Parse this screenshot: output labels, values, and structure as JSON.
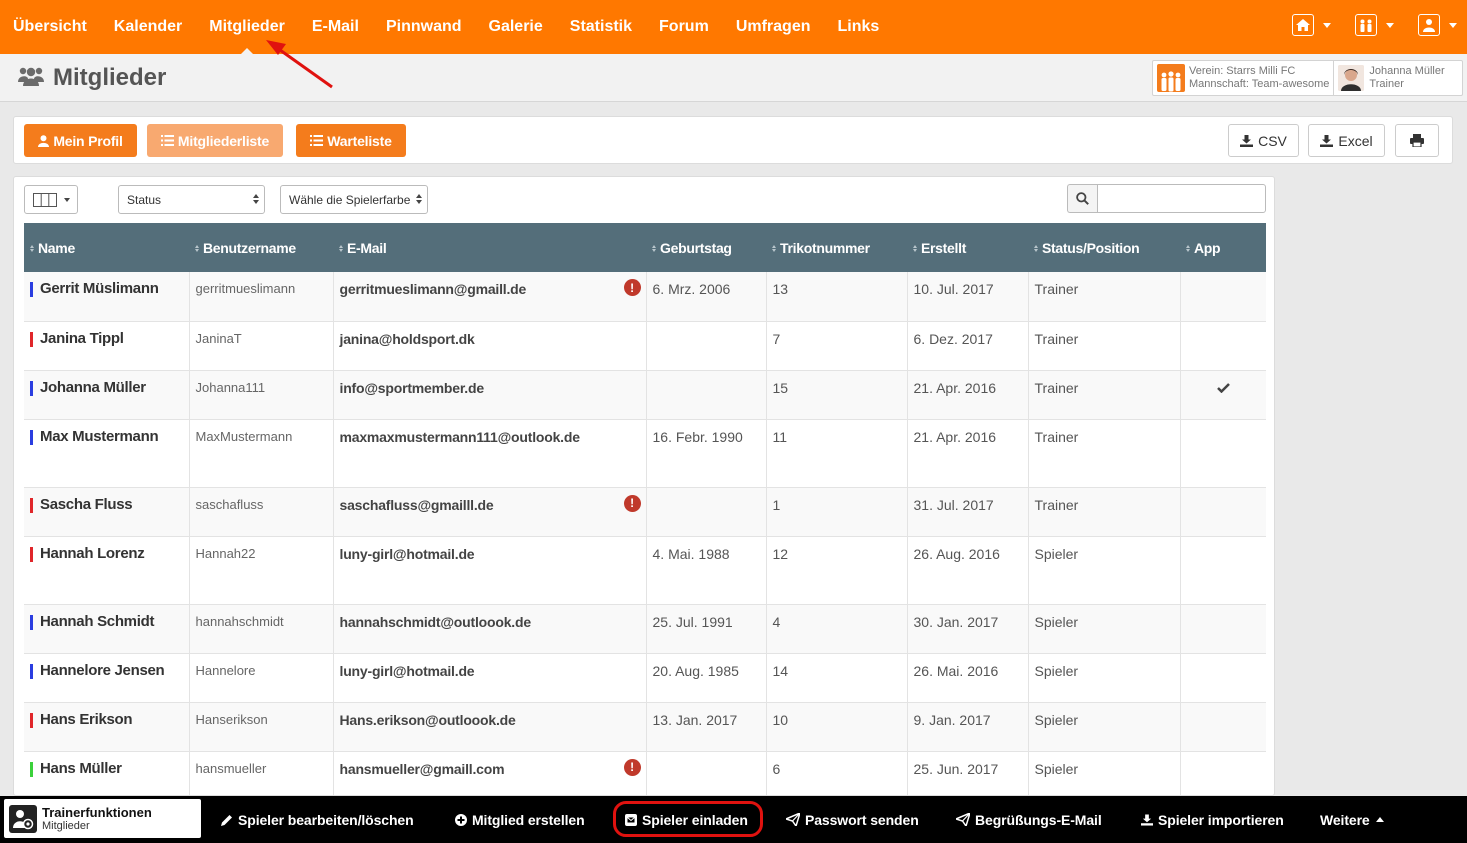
{
  "topnav": {
    "items": [
      "Übersicht",
      "Kalender",
      "Mitglieder",
      "E-Mail",
      "Pinnwand",
      "Galerie",
      "Statistik",
      "Forum",
      "Umfragen",
      "Links"
    ],
    "active": "Mitglieder",
    "right_icons": [
      "home-icon",
      "team-icon",
      "user-icon"
    ]
  },
  "header": {
    "title": "Mitglieder",
    "club_line1": "Verein: Starrs Milli FC",
    "club_line2": "Mannschaft: Team-awesome",
    "user_name": "Johanna Müller",
    "user_role": "Trainer"
  },
  "toolbar": {
    "my_profile": "Mein Profil",
    "member_list": "Mitgliederliste",
    "waiting_list": "Warteliste",
    "csv": "CSV",
    "excel": "Excel",
    "colors": {
      "primary": "#f47c1c",
      "active": "#f8a970"
    }
  },
  "filters": {
    "status": "Status",
    "player_color": "Wähle die Spielerfarbe",
    "search_value": ""
  },
  "table": {
    "columns": [
      "Name",
      "Benutzername",
      "E-Mail",
      "Geburtstag",
      "Trikotnummer",
      "Erstellt",
      "Status/Position",
      "App"
    ],
    "rows": [
      {
        "name": "Gerrit Müslimann",
        "color": "#2a3de0",
        "username": "gerritmueslimann",
        "email": "gerritmueslimann@gmaill.de",
        "warn": true,
        "birthday": "6. Mrz. 2006",
        "number": "13",
        "created": "10. Jul. 2017",
        "status": "Trainer",
        "app": false
      },
      {
        "name": "Janina Tippl",
        "color": "#e0262a",
        "username": "JaninaT",
        "email": "janina@holdsport.dk",
        "warn": false,
        "birthday": "",
        "number": "7",
        "created": "6. Dez. 2017",
        "status": "Trainer",
        "app": false
      },
      {
        "name": "Johanna Müller",
        "color": "#2a3de0",
        "username": "Johanna111",
        "email": "info@sportmember.de",
        "warn": false,
        "birthday": "",
        "number": "15",
        "created": "21. Apr. 2016",
        "status": "Trainer",
        "app": true
      },
      {
        "name": "Max Mustermann",
        "color": "#2a3de0",
        "username": "MaxMustermann",
        "email": "maxmaxmustermann111@outlook.de",
        "warn": false,
        "birthday": "16. Febr. 1990",
        "number": "11",
        "created": "21. Apr. 2016",
        "status": "Trainer",
        "app": false
      },
      {
        "name": "Sascha Fluss",
        "color": "#e0262a",
        "username": "saschafluss",
        "email": "saschafluss@gmailll.de",
        "warn": true,
        "birthday": "",
        "number": "1",
        "created": "31. Jul. 2017",
        "status": "Trainer",
        "app": false
      },
      {
        "name": "Hannah Lorenz",
        "color": "#e0262a",
        "username": "Hannah22",
        "email": "luny-girl@hotmail.de",
        "warn": false,
        "birthday": "4. Mai. 1988",
        "number": "12",
        "created": "26. Aug. 2016",
        "status": "Spieler",
        "app": false
      },
      {
        "name": "Hannah Schmidt",
        "color": "#2a3de0",
        "username": "hannahschmidt",
        "email": "hannahschmidt@outloook.de",
        "warn": false,
        "birthday": "25. Jul. 1991",
        "number": "4",
        "created": "30. Jan. 2017",
        "status": "Spieler",
        "app": false
      },
      {
        "name": "Hannelore Jensen",
        "color": "#2a3de0",
        "username": "Hannelore",
        "email": "luny-girl@hotmail.de",
        "warn": false,
        "birthday": "20. Aug. 1985",
        "number": "14",
        "created": "26. Mai. 2016",
        "status": "Spieler",
        "app": false
      },
      {
        "name": "Hans Erikson",
        "color": "#e0262a",
        "username": "Hanserikson",
        "email": "Hans.erikson@outloook.de",
        "warn": false,
        "birthday": "13. Jan. 2017",
        "number": "10",
        "created": "9. Jan. 2017",
        "status": "Spieler",
        "app": false
      },
      {
        "name": "Hans Müller",
        "color": "#3bd13b",
        "username": "hansmueller",
        "email": "hansmueller@gmaill.com",
        "warn": true,
        "birthday": "",
        "number": "6",
        "created": "25. Jun. 2017",
        "status": "Spieler",
        "app": false
      }
    ]
  },
  "bottombar": {
    "title": "Trainerfunktionen",
    "subtitle": "Mitglieder",
    "edit": "Spieler bearbeiten/löschen",
    "create": "Mitglied erstellen",
    "invite": "Spieler einladen",
    "password": "Passwort senden",
    "welcome": "Begrüßungs-E-Mail",
    "import": "Spieler importieren",
    "more": "Weitere"
  }
}
